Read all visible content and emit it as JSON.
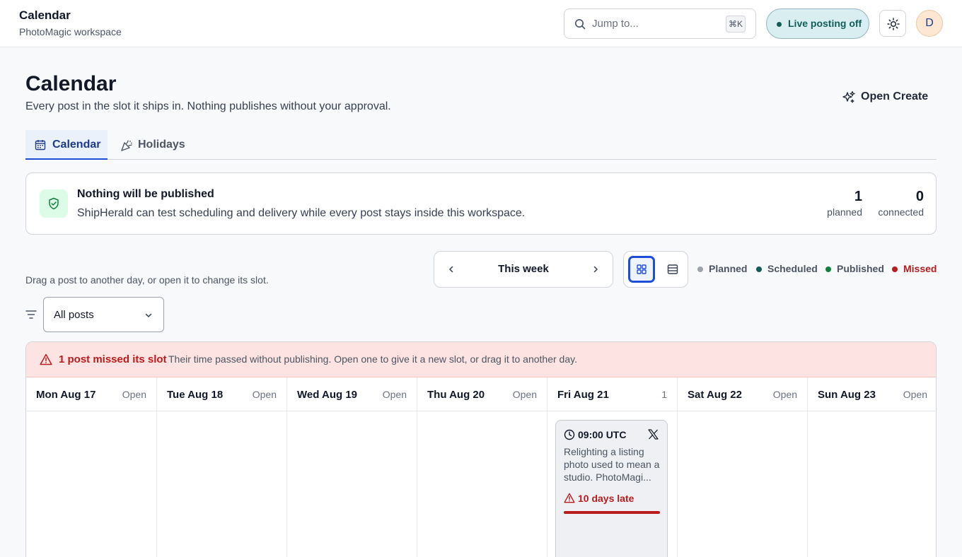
{
  "topbar": {
    "title": "Calendar",
    "workspace": "PhotoMagic workspace",
    "search_placeholder": "Jump to...",
    "search_shortcut": "⌘K",
    "live_posting": "Live posting off",
    "avatar_initial": "D"
  },
  "header": {
    "title": "Calendar",
    "subtitle": "Every post in the slot it ships in. Nothing publishes without your approval.",
    "open_create": "Open Create"
  },
  "tabs": [
    {
      "label": "Calendar",
      "active": true
    },
    {
      "label": "Holidays",
      "active": false
    }
  ],
  "banner": {
    "title": "Nothing will be published",
    "description": "ShipHerald can test scheduling and delivery while every post stays inside this workspace.",
    "stats": [
      {
        "value": "1",
        "label": "planned"
      },
      {
        "value": "0",
        "label": "connected"
      }
    ]
  },
  "controls": {
    "drag_hint": "Drag a post to another day, or open it to change its slot.",
    "week_label": "This week",
    "filter_value": "All posts",
    "legend": [
      {
        "label": "Planned",
        "color": "#9ca3af"
      },
      {
        "label": "Scheduled",
        "color": "#115e59"
      },
      {
        "label": "Published",
        "color": "#15803d"
      },
      {
        "label": "Missed",
        "color": "#b91c1c"
      }
    ]
  },
  "calendar": {
    "missed_title": "1 post missed its slot",
    "missed_desc": "Their time passed without publishing. Open one to give it a new slot, or drag it to another day.",
    "days": [
      {
        "name": "Mon Aug 17",
        "status": "Open"
      },
      {
        "name": "Tue Aug 18",
        "status": "Open"
      },
      {
        "name": "Wed Aug 19",
        "status": "Open"
      },
      {
        "name": "Thu Aug 20",
        "status": "Open"
      },
      {
        "name": "Fri Aug 21",
        "status": "1"
      },
      {
        "name": "Sat Aug 22",
        "status": "Open"
      },
      {
        "name": "Sun Aug 23",
        "status": "Open"
      }
    ],
    "post": {
      "time": "09:00 UTC",
      "text": "Relighting a listing photo used to mean a studio. PhotoMagi...",
      "late": "10 days late",
      "late_progress": 1.0
    }
  }
}
